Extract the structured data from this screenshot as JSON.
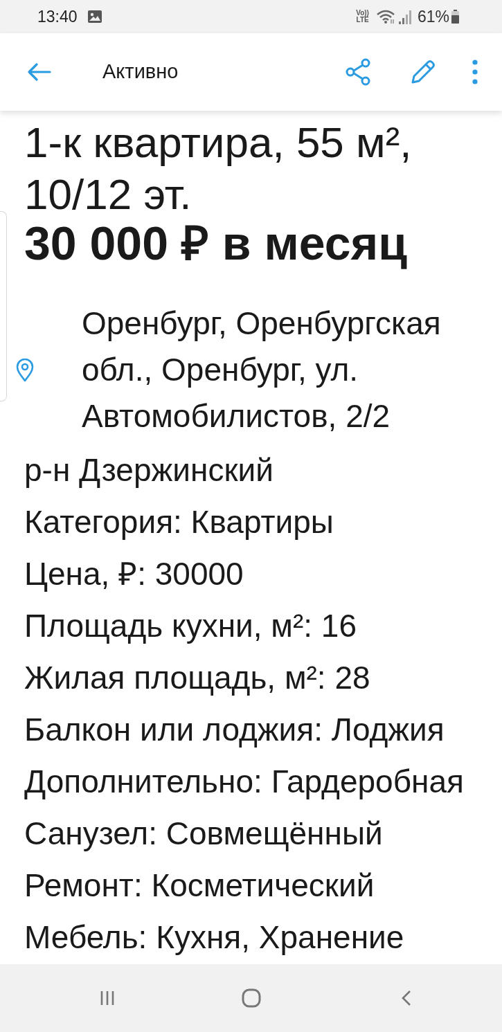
{
  "status_bar": {
    "time": "13:40",
    "volte": {
      "top": "Vo))",
      "bottom": "LTE"
    },
    "battery": "61%"
  },
  "app_bar": {
    "title": "Активно"
  },
  "listing": {
    "title": "1-к квартира, 55 м², 10/12 эт.",
    "price": "30 000 ₽ в месяц",
    "address": "Оренбург, Оренбургская обл., Оренбург, ул. Автомобилистов, 2/2",
    "district": "р-н Дзержинский",
    "details": [
      "Категория: Квартиры",
      "Цена, ₽: 30000",
      "Площадь кухни, м²: 16",
      "Жилая площадь, м²: 28",
      "Балкон или лоджия: Лоджия",
      "Дополнительно: Гардеробная",
      "Санузел: Совмещённый",
      "Ремонт: Косметический",
      "Мебель: Кухня, Хранение"
    ]
  }
}
